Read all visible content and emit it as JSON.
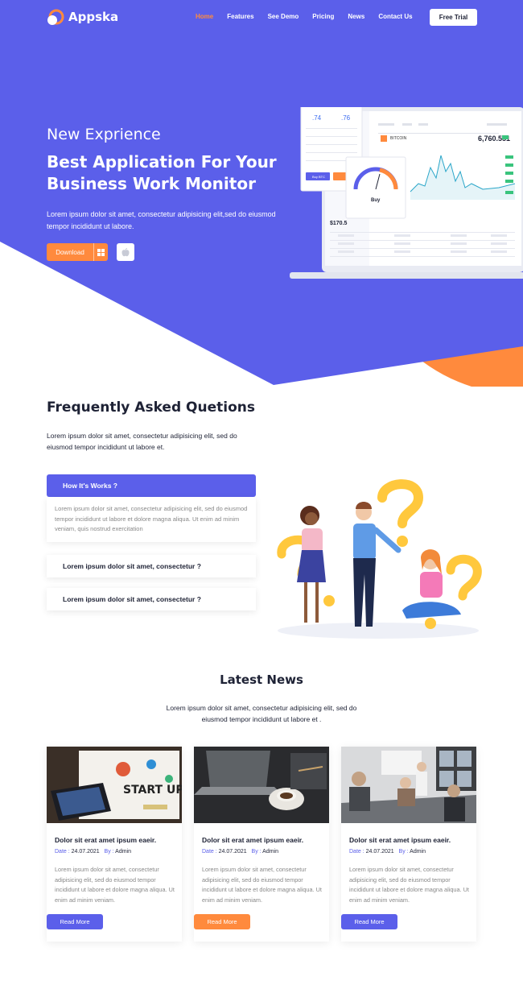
{
  "brand": {
    "name": "Appska",
    "accent": "#5b5fea",
    "orange": "#ff8a3d",
    "dark": "#1e2235"
  },
  "nav": {
    "items": [
      {
        "label": "Home",
        "active": true
      },
      {
        "label": "Features"
      },
      {
        "label": "See Demo"
      },
      {
        "label": "Pricing"
      },
      {
        "label": "News"
      },
      {
        "label": "Contact Us"
      }
    ],
    "cta": "Free Trial"
  },
  "hero": {
    "subtitle": "New Exprience",
    "title": "Best Application For Your Business Work Monitor",
    "text": "Lorem ipsum dolor sit amet, consectetur adipisicing elit,sed do eiusmod tempor incididunt ut labore.",
    "download_label": "Download",
    "download_icon": "windows-icon",
    "apple_icon": "apple-icon",
    "dashboard": {
      "coin": "BITCOIN",
      "price": "6,760.551",
      "small_a": ".74",
      "small_b": ".76",
      "balance": "$170.5",
      "gauge_label": "Buy",
      "buy_btn": "Buy BTC"
    }
  },
  "faq": {
    "title": "Frequently Asked Quetions",
    "text": "Lorem ipsum dolor sit amet, consectetur adipisicing elit, sed do eiusmod tempor incididunt ut labore et.",
    "items": [
      {
        "q": "How It's Works ?",
        "a": "Lorem ipsum dolor sit amet, consectetur adipisicing elit, sed do eiusmod tempor incididunt ut labore et dolore magna aliqua. Ut enim ad minim veniam, quis nostrud exercitation",
        "open": true
      },
      {
        "q": "Lorem ipsum dolor sit amet, consectetur ?"
      },
      {
        "q": "Lorem ipsum dolor sit amet, consectetur ?"
      }
    ]
  },
  "news": {
    "title": "Latest News",
    "text": "Lorem ipsum dolor sit amet, consectetur adipisicing elit, sed do eiusmod tempor incididunt ut labore et .",
    "cards": [
      {
        "title": "Dolor sit erat amet ipsum eaeir.",
        "date_label": "Date :",
        "date": "24.07.2021",
        "by_label": "By :",
        "author": "Admin",
        "excerpt": "Lorem ipsum dolor sit amet, consectetur adipisicing elit, sed do eiusmod tempor incididunt ut labore et dolore magna aliqua. Ut enim ad minim veniam.",
        "button": "Read More",
        "button_color": "#5b5fea",
        "image_text": "START UP"
      },
      {
        "title": "Dolor sit erat amet ipsum eaeir.",
        "date_label": "Date :",
        "date": "24.07.2021",
        "by_label": "By :",
        "author": "Admin",
        "excerpt": "Lorem ipsum dolor sit amet, consectetur adipisicing elit, sed do eiusmod tempor incididunt ut labore et dolore magna aliqua. Ut enim ad minim veniam.",
        "button": "Read More",
        "button_color": "#ff8a3d"
      },
      {
        "title": "Dolor sit erat amet ipsum eaeir.",
        "date_label": "Date :",
        "date": "24.07.2021",
        "by_label": "By :",
        "author": "Admin",
        "excerpt": "Lorem ipsum dolor sit amet, consectetur adipisicing elit, sed do eiusmod tempor incididunt ut labore et dolore magna aliqua. Ut enim ad minim veniam.",
        "button": "Read More",
        "button_color": "#5b5fea"
      }
    ]
  }
}
